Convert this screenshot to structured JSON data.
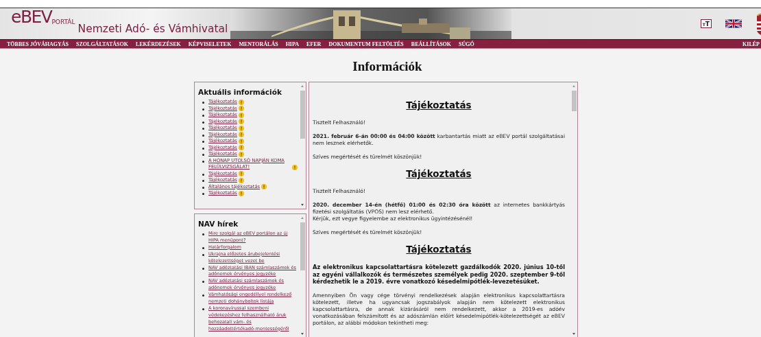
{
  "header": {
    "logo": "eBEV",
    "logo_suffix": "PORTÁL",
    "agency": "Nemzeti Adó- és Vámhivatal",
    "font_size_button": "TT"
  },
  "nav": {
    "items": [
      "TÖBBES JÓVÁHAGYÁS",
      "SZOLGÁLTATÁSOK",
      "LEKÉRDEZÉSEK",
      "KÉPVISELETEK",
      "MENTORÁLÁS",
      "HIPA",
      "EFER",
      "DOKUMENTUM FELTÖLTÉS",
      "BEÁLLÍTÁSOK",
      "SÚGÓ"
    ],
    "logout": "KILÉP"
  },
  "page_title": "Információk",
  "current_info": {
    "title": "Aktuális információk",
    "items": [
      {
        "text": "Tájékoztatás",
        "alert": true
      },
      {
        "text": "Tájékoztatás",
        "alert": true
      },
      {
        "text": "Tájékoztatás",
        "alert": true
      },
      {
        "text": "Tájékoztatás",
        "alert": true
      },
      {
        "text": "Tájékoztatás",
        "alert": true
      },
      {
        "text": "Tájékoztatás",
        "alert": true
      },
      {
        "text": "Tájékoztatás",
        "alert": true
      },
      {
        "text": "Tájékoztatás",
        "alert": true
      },
      {
        "text": "Tájékoztatás",
        "alert": true
      },
      {
        "text": "A HÓNAP UTOLSÓ NAPJÁN KOMA FELÜLVIZSGÁLAT!",
        "alert": true
      },
      {
        "text": "Tájékoztatás",
        "alert": true
      },
      {
        "text": "Tájékoztatás",
        "alert": true
      },
      {
        "text": "Általános tájékoztatás",
        "alert": true
      },
      {
        "text": "Tájékoztatás",
        "alert": true
      }
    ]
  },
  "nav_news": {
    "title": "NAV hírek",
    "items": [
      "Mire szolgál az eBEV portálon az új HIPA menüpont?",
      "Határforgalom",
      "Ukrajna előzetes árubejelentési kötelezettséget vezet be",
      "NAV adóztatási IBAN számlaszámok és adónemek érvényes jegyzéke",
      "NAV adóztatási számlaszámok és adónemek érvényes jegyzéke",
      "Vámhatósági engedéllyel rendelkező nemzeti dohányboltok listája",
      "A koronavírussal szembeni védekezéshez felhasználható áruk behozatali vám- és hozzáadottértékadó-mentességéről"
    ]
  },
  "notices": [
    {
      "heading": "Tájékoztatás",
      "paragraphs": [
        {
          "kind": "plain",
          "text": "Tisztelt Felhasználó!"
        },
        {
          "kind": "plain",
          "text": "**2021. február 6-án 00:00 és 04:00 között** karbantartás miatt az eBEV portál szolgáltatásai nem lesznek elérhetők."
        },
        {
          "kind": "plain",
          "text": "Szíves megértését és türelmét köszönjük!"
        }
      ]
    },
    {
      "heading": "Tájékoztatás",
      "paragraphs": [
        {
          "kind": "plain",
          "text": "Tisztelt Felhasználó!"
        },
        {
          "kind": "plain",
          "text": "**2020. december 14-én (hétfő) 01:00 és 02:30 óra között** az internetes bankkártyás fizetési szolgáltatás (VPOS) nem lesz elérhető.\nKérjük, ezt vegye figyelembe az elektronikus ügyintézésénél!"
        },
        {
          "kind": "plain",
          "text": "Szíves megértését és türelmét köszönjük!"
        }
      ]
    },
    {
      "heading": "Tájékoztatás",
      "paragraphs": [
        {
          "kind": "bold",
          "text": "Az elektronikus kapcsolattartásra kötelezett gazdálkodók 2020. június 10-től az egyéni vállalkozók és természetes személyek pedig 2020. szeptember 9-től kérdezhetik le a 2019. évre vonatkozó késedelmipótlék-levezetésüket."
        },
        {
          "kind": "plain",
          "text": "Amennyiben Ön vagy cége törvényi rendelkezések alapján elektronikus kapcsolattartásra kötelezett, illetve ha ugyancsak jogszabályok alapján nem kötelezett elektronikus kapcsolattartásra, de annak kizárásáról nem rendelkezett, akkor a 2019-es adóév vonatkozásában felszámított és az adószámlán előírt késedelmipótlék-kötelezettségét az eBEV portálon, az alábbi módokon tekintheti meg:"
        }
      ]
    }
  ]
}
